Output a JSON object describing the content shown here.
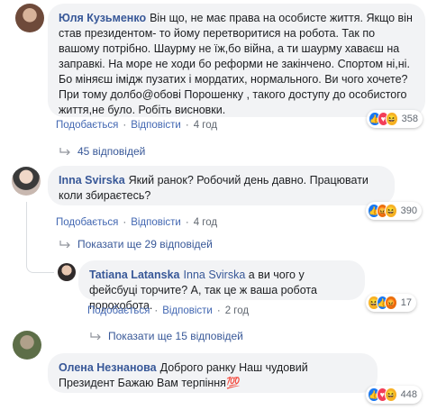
{
  "comments": [
    {
      "author": "Юля Кузьменко",
      "text": "Він що, не має права на особисте життя. Якщо він став президентом- то йому перетворитися на робота. Так по вашому потрібно. Шаурму не їж,бо війна, а ти шаурму хаваєш на заправкі. На море не ходи бо реформи не закінчено. Спортом ні,ні. Бо міняєш імідж пузатих і мордатих, нормального. Ви чого хочете? При тому долбо@обові Порошенку , такого доступу до особистого життя,не було. Робіть висновки.",
      "reaction_count": "358",
      "like": "Подобається",
      "reply": "Відповісти",
      "time": "4 год",
      "replies_link": "45 відповідей"
    },
    {
      "author": "Inna Svirska",
      "text": "Який ранок? Робочий день давно. Працювати коли збираєтесь?",
      "reaction_count": "390",
      "like": "Подобається",
      "reply": "Відповісти",
      "time": "4 год",
      "replies_link": "Показати ще 29 відповідей"
    },
    {
      "author": "Tatiana Latanska",
      "mention": "Inna Svirska",
      "text": " а ви чого у фейсбуці торчите? А, так це ж ваша робота порохобота.",
      "reaction_count": "17",
      "like": "Подобається",
      "reply": "Відповісти",
      "time": "2 год",
      "replies_link": "Показати ще 15 відповідей"
    },
    {
      "author": "Олена Незнанова",
      "text": "Доброго ранку Наш чудовий Президент Бажаю Вам терпіння💯",
      "reaction_count": "448"
    }
  ],
  "colors": {
    "link": "#385898",
    "bubble": "#f2f3f5",
    "meta": "#606770"
  }
}
